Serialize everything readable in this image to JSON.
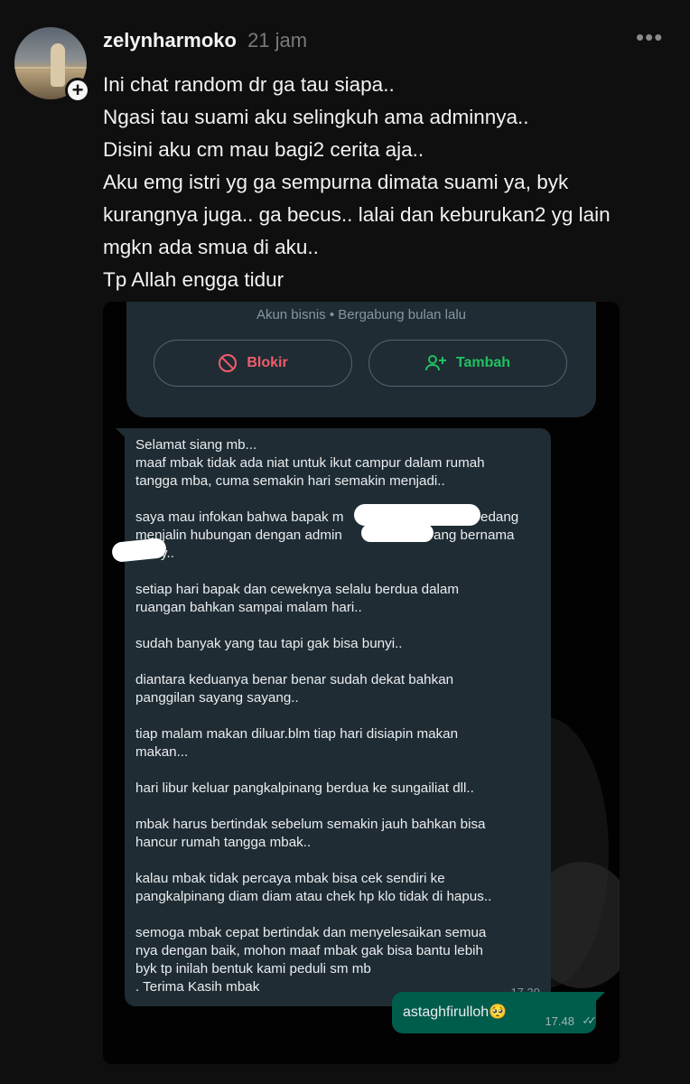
{
  "post": {
    "username": "zelynharmoko",
    "time_ago": "21 jam",
    "more_icon": "•••",
    "follow_icon": "+",
    "text_lines": [
      "Ini chat random dr ga tau siapa..",
      "Ngasi tau suami aku selingkuh ama adminnya..",
      "Disini aku cm mau bagi2 cerita aja..",
      "Aku emg istri yg ga sempurna dimata suami ya, byk",
      "kurangnya juga.. ga becus.. lalai dan keburukan2 yg lain",
      "mgkn ada smua di aku..",
      "Tp Allah engga tidur"
    ]
  },
  "screenshot": {
    "contact_subtitle": "Akun bisnis • Bergabung bulan lalu",
    "block_label": "Blokir",
    "add_label": "Tambah",
    "colors": {
      "block": "#f15c6d",
      "add": "#21c063",
      "bubble_in": "#1f2c33",
      "bubble_out": "#005c4b"
    },
    "incoming_message": {
      "lines": [
        "Selamat siang mb...",
        "maaf mbak tidak ada niat untuk ikut campur dalam rumah",
        "tangga mba, cuma semakin hari semakin menjadi..",
        "saya mau infokan bahwa bapak m",
        "edang",
        "menjalin hubungan dengan admin",
        "ang bernama",
        "y..",
        "setiap hari bapak dan ceweknya selalu berdua dalam",
        "ruangan bahkan sampai malam hari..",
        "sudah banyak yang tau tapi gak bisa bunyi..",
        "diantara keduanya benar benar sudah dekat bahkan",
        "panggilan sayang sayang..",
        "tiap malam makan diluar.blm tiap hari disiapin makan",
        "makan...",
        "hari libur keluar pangkalpinang berdua ke sungailiat dll..",
        "mbak harus bertindak sebelum semakin jauh bahkan bisa",
        "hancur rumah tangga mbak..",
        "kalau mbak tidak percaya mbak bisa cek sendiri ke",
        "pangkalpinang diam diam atau chek hp klo tidak di hapus..",
        "semoga mbak cepat bertindak dan menyelesaikan semua",
        "nya dengan baik, mohon maaf mbak gak bisa bantu lebih",
        "byk tp inilah bentuk kami peduli sm mb",
        ". Terima Kasih mbak"
      ],
      "time": "17.39"
    },
    "outgoing_message": {
      "text": "astaghfirulloh🥺",
      "time": "17.48",
      "status_icon": "✓✓"
    }
  }
}
